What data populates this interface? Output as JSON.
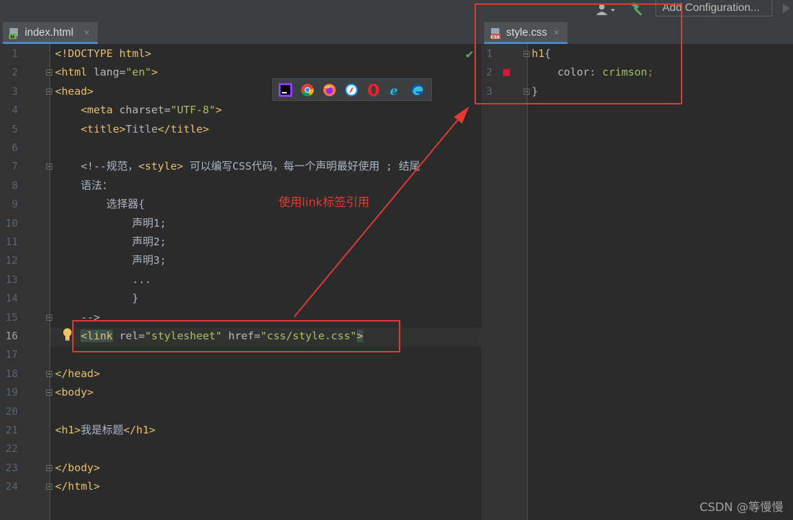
{
  "toolbar": {
    "config_label": "Add Configuration..."
  },
  "tabs": {
    "left": {
      "label": "index.html",
      "close": "×"
    },
    "right": {
      "label": "style.css",
      "close": "×"
    }
  },
  "left_editor": {
    "current_line": 16,
    "line_numbers": [
      "1",
      "2",
      "3",
      "4",
      "5",
      "6",
      "7",
      "8",
      "9",
      "10",
      "11",
      "12",
      "13",
      "14",
      "15",
      "16",
      "17",
      "18",
      "19",
      "20",
      "21",
      "22",
      "23",
      "24"
    ],
    "lines": [
      [
        {
          "t": "<!DOCTYPE html>",
          "c": "tag"
        }
      ],
      [
        {
          "t": "<html ",
          "c": "tag"
        },
        {
          "t": "lang=",
          "c": "attr"
        },
        {
          "t": "\"en\"",
          "c": "str"
        },
        {
          "t": ">",
          "c": "tag"
        }
      ],
      [
        {
          "t": "<head>",
          "c": "tag"
        }
      ],
      [
        {
          "t": "    "
        },
        {
          "t": "<meta ",
          "c": "tag"
        },
        {
          "t": "charset=",
          "c": "attr"
        },
        {
          "t": "\"UTF-8\"",
          "c": "str"
        },
        {
          "t": ">",
          "c": "tag"
        }
      ],
      [
        {
          "t": "    "
        },
        {
          "t": "<title>",
          "c": "tag"
        },
        {
          "t": "Title",
          "c": "txt"
        },
        {
          "t": "</title>",
          "c": "tag"
        }
      ],
      [],
      [
        {
          "t": "    "
        },
        {
          "t": "<!--规范，",
          "c": "cmt2"
        },
        {
          "t": "<style>",
          "c": "tag"
        },
        {
          "t": " 可以编写CSS代码，每一个声明最好使用 ; 结尾",
          "c": "cmt2"
        }
      ],
      [
        {
          "t": "    "
        },
        {
          "t": "语法：",
          "c": "cmt2"
        }
      ],
      [
        {
          "t": "        "
        },
        {
          "t": "选择器{",
          "c": "cmt2"
        }
      ],
      [
        {
          "t": "            "
        },
        {
          "t": "声明1;",
          "c": "cmt2"
        }
      ],
      [
        {
          "t": "            "
        },
        {
          "t": "声明2;",
          "c": "cmt2"
        }
      ],
      [
        {
          "t": "            "
        },
        {
          "t": "声明3;",
          "c": "cmt2"
        }
      ],
      [
        {
          "t": "            "
        },
        {
          "t": "...",
          "c": "cmt2"
        }
      ],
      [
        {
          "t": "            "
        },
        {
          "t": "}",
          "c": "cmt2"
        }
      ],
      [
        {
          "t": "    "
        },
        {
          "t": "-->",
          "c": "cmt2"
        }
      ],
      [
        {
          "t": "    "
        },
        {
          "t": "<link",
          "c": "tag",
          "hl": true
        },
        {
          "t": " rel=",
          "c": "attr"
        },
        {
          "t": "\"stylesheet\"",
          "c": "str"
        },
        {
          "t": " href=",
          "c": "attr"
        },
        {
          "t": "\"css/style.css\"",
          "c": "str"
        },
        {
          "t": ">",
          "c": "tag",
          "hl": true
        }
      ],
      [],
      [
        {
          "t": "</head>",
          "c": "tag"
        }
      ],
      [
        {
          "t": "<body>",
          "c": "tag"
        }
      ],
      [],
      [
        {
          "t": "<h1>",
          "c": "tag"
        },
        {
          "t": "我是标题",
          "c": "txt"
        },
        {
          "t": "</h1>",
          "c": "tag"
        }
      ],
      [],
      [
        {
          "t": "</body>",
          "c": "tag"
        }
      ],
      [
        {
          "t": "</html>",
          "c": "tag"
        }
      ]
    ],
    "fold_lines": [
      2,
      3,
      7,
      15,
      18,
      19,
      23,
      24
    ]
  },
  "right_editor": {
    "line_numbers": [
      "1",
      "2",
      "3"
    ],
    "lines": [
      [
        {
          "t": "h1",
          "c": "sel"
        },
        {
          "t": "{",
          "c": "txt"
        }
      ],
      [
        {
          "t": "    "
        },
        {
          "t": "color",
          "c": "prop"
        },
        {
          "t": ": ",
          "c": "txt"
        },
        {
          "t": "crimson",
          "c": "val"
        },
        {
          "t": ";",
          "c": "punct"
        }
      ],
      [
        {
          "t": "}",
          "c": "txt"
        }
      ]
    ],
    "fold_lines": [
      1,
      3
    ],
    "swatch_color": "#dc143c"
  },
  "browsers": [
    "intellij-icon",
    "chrome-icon",
    "firefox-icon",
    "safari-icon",
    "opera-icon",
    "ie-icon",
    "edge-icon"
  ],
  "annotation": {
    "label": "使用link标签引用",
    "color": "#e53935"
  },
  "watermark": "CSDN @等慢慢"
}
